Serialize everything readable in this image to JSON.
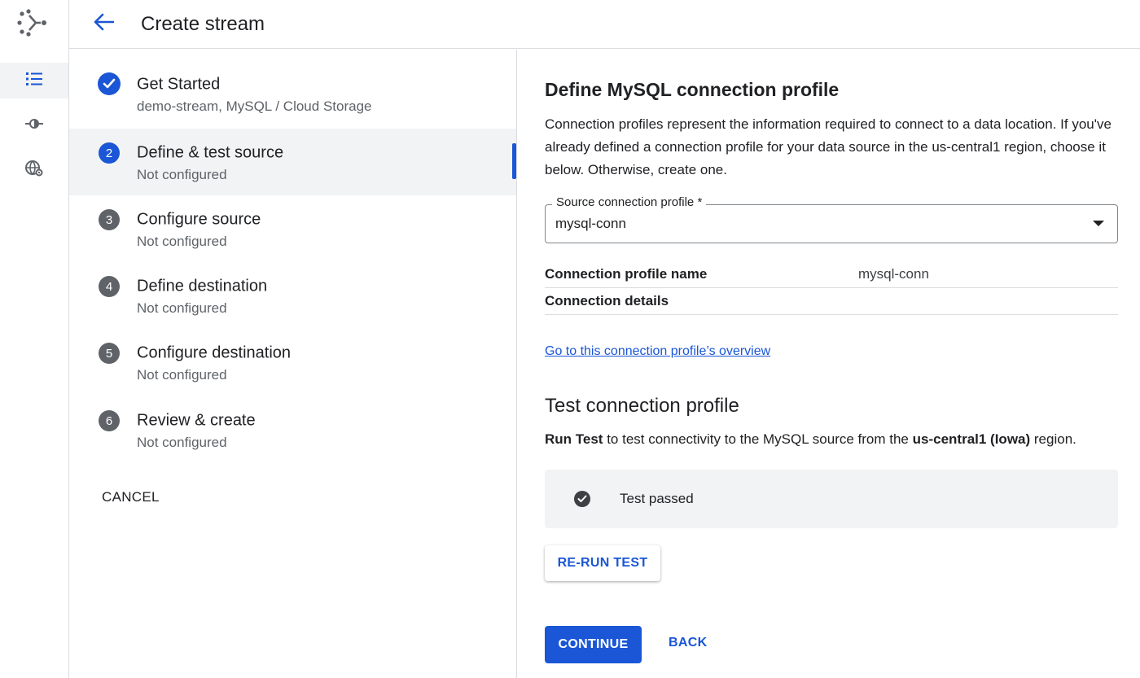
{
  "header": {
    "title": "Create stream"
  },
  "rail": {
    "items": [
      {
        "icon": "list-icon",
        "active": true
      },
      {
        "icon": "connection-icon",
        "active": false
      },
      {
        "icon": "globe-settings-icon",
        "active": false
      }
    ]
  },
  "stepper": {
    "steps": [
      {
        "number": "1",
        "title": "Get Started",
        "subtitle": "demo-stream, MySQL / Cloud Storage",
        "state": "completed"
      },
      {
        "number": "2",
        "title": "Define & test source",
        "subtitle": "Not configured",
        "state": "active"
      },
      {
        "number": "3",
        "title": "Configure source",
        "subtitle": "Not configured",
        "state": "pending"
      },
      {
        "number": "4",
        "title": "Define destination",
        "subtitle": "Not configured",
        "state": "pending"
      },
      {
        "number": "5",
        "title": "Configure destination",
        "subtitle": "Not configured",
        "state": "pending"
      },
      {
        "number": "6",
        "title": "Review & create",
        "subtitle": "Not configured",
        "state": "pending"
      }
    ],
    "cancel_label": "CANCEL"
  },
  "main": {
    "heading": "Define MySQL connection profile",
    "description": "Connection profiles represent the information required to connect to a data location. If you've already defined a connection profile for your data source in the us-central1 region, choose it below. Otherwise, create one.",
    "select": {
      "label": "Source connection profile *",
      "value": "mysql-conn"
    },
    "details": {
      "name_key": "Connection profile name",
      "name_value": "mysql-conn",
      "details_key": "Connection details"
    },
    "overview_link": "Go to this connection profile’s overview",
    "test_heading": "Test connection profile",
    "run_prefix": "Run Test",
    "run_middle": " to test connectivity to the MySQL source from the ",
    "run_region": "us-central1 (Iowa)",
    "run_suffix": " region.",
    "test_status": "Test passed",
    "rerun_label": "RE-RUN TEST",
    "continue_label": "CONTINUE",
    "back_label": "BACK"
  },
  "colors": {
    "accent": "#1a56d6",
    "step_pending": "#5f6368",
    "active_background": "#f1f3f4"
  }
}
